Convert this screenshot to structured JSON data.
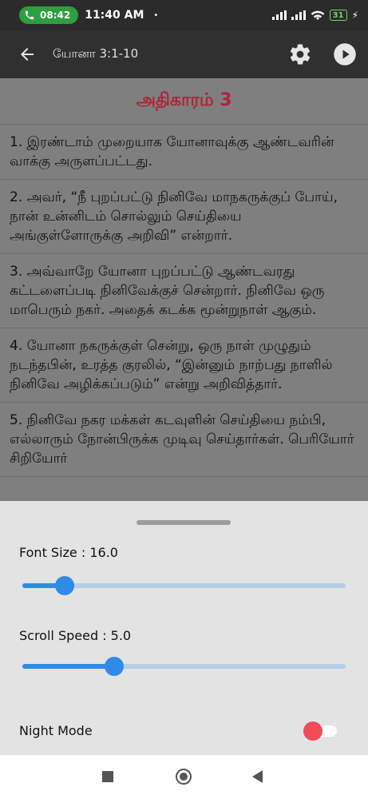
{
  "status_bar": {
    "call_time": "08:42",
    "clock": "11:40 AM",
    "dot": "•",
    "battery": "31",
    "network_label": "ıll ıll"
  },
  "app_bar": {
    "title": "யோனா 3:1-10"
  },
  "content": {
    "chapter_title": "அதிகாரம் 3",
    "verses": [
      "1. இரண்டாம் முறையாக யோனாவுக்கு ஆண்டவரின் வாக்கு அருளப்பட்டது.",
      "2. அவர், “நீ புறப்பட்டு நினிவே மாநகருக்குப் போய், நான் உன்னிடம் சொல்லும் செய்தியை அங்குள்ளோருக்கு அறிவி” என்றார்.",
      "3. அவ்வாறே யோனா புறப்பட்டு ஆண்டவரது கட்டளைப்படி நினிவேக்குச் சென்றார். நினிவே ஒரு மாபெரும் நகர். அதைக் கடக்க மூன்றுநாள் ஆகும்.",
      "4. யோனா நகருக்குள் சென்று, ஒரு நாள் முழுதும் நடந்தபின், உரத்த குரலில், “இன்னும் நாற்பது நாளில் நினிவே அழிக்கப்படும்” என்று அறிவித்தார்.",
      "5. நினிவே நகர மக்கள் கடவுளின் செய்தியை நம்பி, எல்லாரும் நோன்பிருக்க முடிவு செய்தார்கள். பெரியோர் சிறியோர்"
    ]
  },
  "settings_sheet": {
    "font_size_label": "Font Size : 16.0",
    "font_size_fraction": 0.13,
    "scroll_speed_label": "Scroll Speed : 5.0",
    "scroll_speed_fraction": 0.285,
    "night_mode_label": "Night Mode",
    "night_mode_on": false
  },
  "colors": {
    "accent": "#2f8be8",
    "chapter_title": "#b0243a",
    "toggle_knob": "#f24b57",
    "call_pill": "#2e9e3f"
  }
}
